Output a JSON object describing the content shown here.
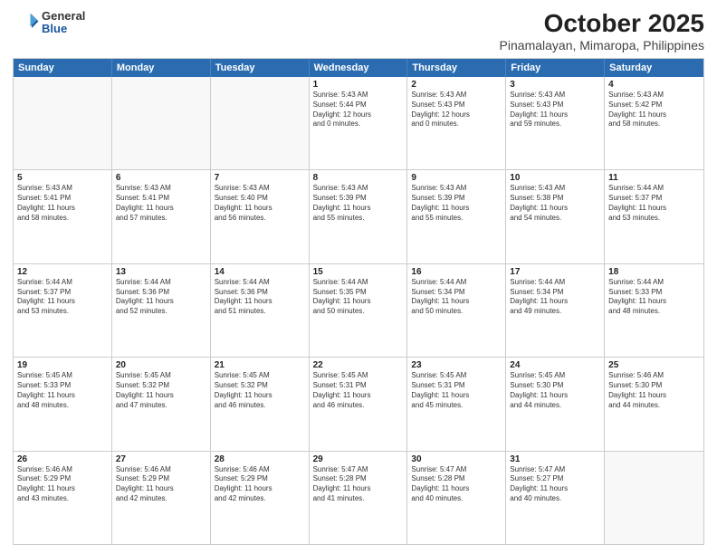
{
  "logo": {
    "general": "General",
    "blue": "Blue"
  },
  "header": {
    "title": "October 2025",
    "subtitle": "Pinamalayan, Mimaropa, Philippines"
  },
  "days": [
    "Sunday",
    "Monday",
    "Tuesday",
    "Wednesday",
    "Thursday",
    "Friday",
    "Saturday"
  ],
  "rows": [
    [
      {
        "day": "",
        "content": ""
      },
      {
        "day": "",
        "content": ""
      },
      {
        "day": "",
        "content": ""
      },
      {
        "day": "1",
        "content": "Sunrise: 5:43 AM\nSunset: 5:44 PM\nDaylight: 12 hours\nand 0 minutes."
      },
      {
        "day": "2",
        "content": "Sunrise: 5:43 AM\nSunset: 5:43 PM\nDaylight: 12 hours\nand 0 minutes."
      },
      {
        "day": "3",
        "content": "Sunrise: 5:43 AM\nSunset: 5:43 PM\nDaylight: 11 hours\nand 59 minutes."
      },
      {
        "day": "4",
        "content": "Sunrise: 5:43 AM\nSunset: 5:42 PM\nDaylight: 11 hours\nand 58 minutes."
      }
    ],
    [
      {
        "day": "5",
        "content": "Sunrise: 5:43 AM\nSunset: 5:41 PM\nDaylight: 11 hours\nand 58 minutes."
      },
      {
        "day": "6",
        "content": "Sunrise: 5:43 AM\nSunset: 5:41 PM\nDaylight: 11 hours\nand 57 minutes."
      },
      {
        "day": "7",
        "content": "Sunrise: 5:43 AM\nSunset: 5:40 PM\nDaylight: 11 hours\nand 56 minutes."
      },
      {
        "day": "8",
        "content": "Sunrise: 5:43 AM\nSunset: 5:39 PM\nDaylight: 11 hours\nand 55 minutes."
      },
      {
        "day": "9",
        "content": "Sunrise: 5:43 AM\nSunset: 5:39 PM\nDaylight: 11 hours\nand 55 minutes."
      },
      {
        "day": "10",
        "content": "Sunrise: 5:43 AM\nSunset: 5:38 PM\nDaylight: 11 hours\nand 54 minutes."
      },
      {
        "day": "11",
        "content": "Sunrise: 5:44 AM\nSunset: 5:37 PM\nDaylight: 11 hours\nand 53 minutes."
      }
    ],
    [
      {
        "day": "12",
        "content": "Sunrise: 5:44 AM\nSunset: 5:37 PM\nDaylight: 11 hours\nand 53 minutes."
      },
      {
        "day": "13",
        "content": "Sunrise: 5:44 AM\nSunset: 5:36 PM\nDaylight: 11 hours\nand 52 minutes."
      },
      {
        "day": "14",
        "content": "Sunrise: 5:44 AM\nSunset: 5:36 PM\nDaylight: 11 hours\nand 51 minutes."
      },
      {
        "day": "15",
        "content": "Sunrise: 5:44 AM\nSunset: 5:35 PM\nDaylight: 11 hours\nand 50 minutes."
      },
      {
        "day": "16",
        "content": "Sunrise: 5:44 AM\nSunset: 5:34 PM\nDaylight: 11 hours\nand 50 minutes."
      },
      {
        "day": "17",
        "content": "Sunrise: 5:44 AM\nSunset: 5:34 PM\nDaylight: 11 hours\nand 49 minutes."
      },
      {
        "day": "18",
        "content": "Sunrise: 5:44 AM\nSunset: 5:33 PM\nDaylight: 11 hours\nand 48 minutes."
      }
    ],
    [
      {
        "day": "19",
        "content": "Sunrise: 5:45 AM\nSunset: 5:33 PM\nDaylight: 11 hours\nand 48 minutes."
      },
      {
        "day": "20",
        "content": "Sunrise: 5:45 AM\nSunset: 5:32 PM\nDaylight: 11 hours\nand 47 minutes."
      },
      {
        "day": "21",
        "content": "Sunrise: 5:45 AM\nSunset: 5:32 PM\nDaylight: 11 hours\nand 46 minutes."
      },
      {
        "day": "22",
        "content": "Sunrise: 5:45 AM\nSunset: 5:31 PM\nDaylight: 11 hours\nand 46 minutes."
      },
      {
        "day": "23",
        "content": "Sunrise: 5:45 AM\nSunset: 5:31 PM\nDaylight: 11 hours\nand 45 minutes."
      },
      {
        "day": "24",
        "content": "Sunrise: 5:45 AM\nSunset: 5:30 PM\nDaylight: 11 hours\nand 44 minutes."
      },
      {
        "day": "25",
        "content": "Sunrise: 5:46 AM\nSunset: 5:30 PM\nDaylight: 11 hours\nand 44 minutes."
      }
    ],
    [
      {
        "day": "26",
        "content": "Sunrise: 5:46 AM\nSunset: 5:29 PM\nDaylight: 11 hours\nand 43 minutes."
      },
      {
        "day": "27",
        "content": "Sunrise: 5:46 AM\nSunset: 5:29 PM\nDaylight: 11 hours\nand 42 minutes."
      },
      {
        "day": "28",
        "content": "Sunrise: 5:46 AM\nSunset: 5:29 PM\nDaylight: 11 hours\nand 42 minutes."
      },
      {
        "day": "29",
        "content": "Sunrise: 5:47 AM\nSunset: 5:28 PM\nDaylight: 11 hours\nand 41 minutes."
      },
      {
        "day": "30",
        "content": "Sunrise: 5:47 AM\nSunset: 5:28 PM\nDaylight: 11 hours\nand 40 minutes."
      },
      {
        "day": "31",
        "content": "Sunrise: 5:47 AM\nSunset: 5:27 PM\nDaylight: 11 hours\nand 40 minutes."
      },
      {
        "day": "",
        "content": ""
      }
    ]
  ]
}
